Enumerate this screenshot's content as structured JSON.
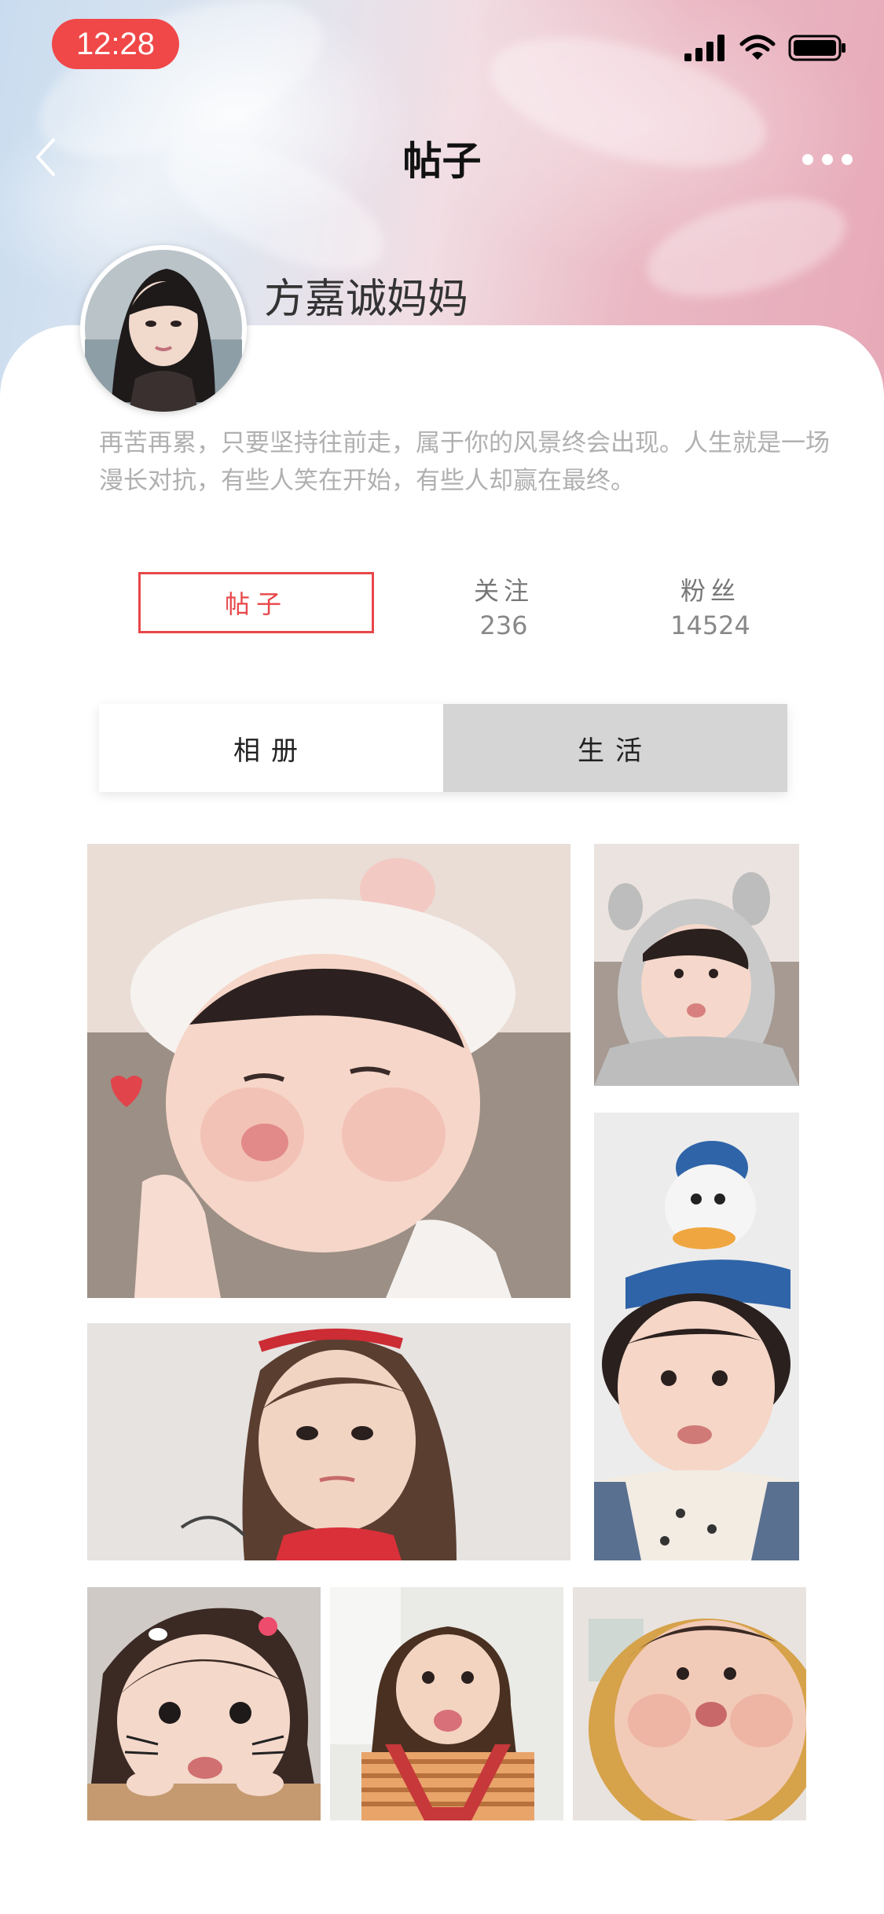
{
  "status_bar": {
    "time": "12:28",
    "signal_icon": "signal-bars-icon",
    "wifi_icon": "wifi-icon",
    "battery_icon": "battery-icon"
  },
  "nav": {
    "title": "帖子",
    "back_icon": "chevron-left-icon",
    "more_icon": "more-dots-icon"
  },
  "profile": {
    "name": "方嘉诚妈妈",
    "bio": "再苦再累，只要坚持往前走，属于你的风景终会出现。人生就是一场漫长对抗，有些人笑在开始，有些人却赢在最终。"
  },
  "stats": {
    "posts_label": "帖子",
    "following_label": "关注",
    "following_count": "236",
    "fans_label": "粉丝",
    "fans_count": "14524"
  },
  "tabs": {
    "album": "相册",
    "life": "生活",
    "active": "album"
  },
  "colors": {
    "accent": "#e8474a",
    "status_time_bg": "#f04848",
    "tab_inactive_bg": "#d5d5d5"
  }
}
